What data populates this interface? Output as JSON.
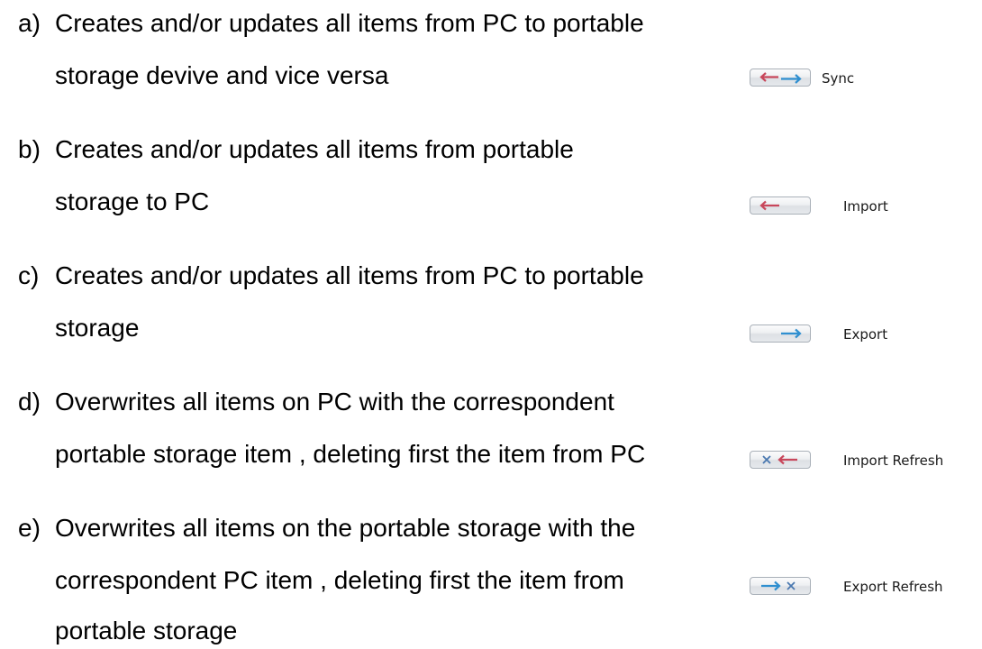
{
  "items": [
    {
      "marker": "a)",
      "lines": [
        "Creates and/or updates all items from PC to portable",
        "storage devive and vice versa"
      ],
      "button_icon": "left-right-arrows-icon",
      "label": "Sync"
    },
    {
      "marker": "b)",
      "lines": [
        "Creates and/or updates all items from portable",
        "storage to PC"
      ],
      "button_icon": "left-arrow-icon",
      "label": "Import"
    },
    {
      "marker": "c)",
      "lines": [
        "Creates and/or updates all items from PC to portable",
        "storage"
      ],
      "button_icon": "right-arrow-icon",
      "label": "Export"
    },
    {
      "marker": "d)",
      "lines": [
        "Overwrites all items on PC with the correspondent",
        "portable storage item , deleting first the item from PC"
      ],
      "button_icon": "delete-left-arrow-icon",
      "label": "Import Refresh"
    },
    {
      "marker": "e)",
      "lines": [
        "Overwrites all items on the portable storage with the",
        "correspondent PC item , deleting first the item from",
        "portable storage"
      ],
      "button_icon": "right-arrow-delete-icon",
      "label": "Export Refresh"
    }
  ],
  "colors": {
    "left_arrow": "#c8475b",
    "right_arrow": "#2f8fd0",
    "cross": "#4a78b0"
  }
}
